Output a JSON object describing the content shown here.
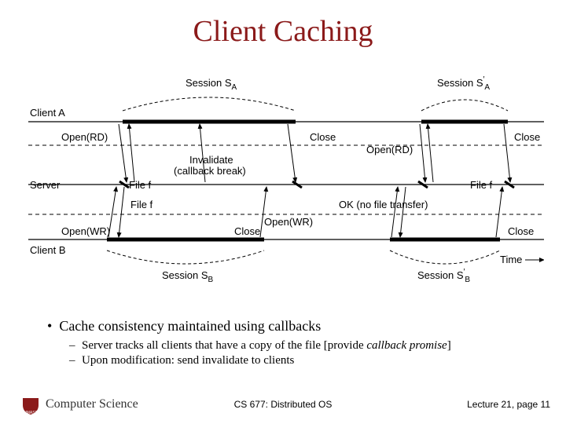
{
  "title": "Client Caching",
  "diagram": {
    "clientA": "Client A",
    "clientB": "Client B",
    "server": "Server",
    "openRD": "Open(RD)",
    "openWR": "Open(WR)",
    "close": "Close",
    "filef": "File f",
    "invalidate1": "Invalidate",
    "invalidate2": "(callback break)",
    "okNoTransfer": "OK (no file transfer)",
    "sessionSA": "Session S",
    "sessionSB": "Session S",
    "subA": "A",
    "subB": "B",
    "time": "Time"
  },
  "bullets": {
    "main": "Cache consistency maintained using callbacks",
    "sub1_a": "Server tracks all clients that have a copy of the file [provide ",
    "sub1_b": "callback promise",
    "sub1_c": "]",
    "sub2": "Upon modification: send invalidate to clients"
  },
  "footer": {
    "dept": "Computer Science",
    "course": "CS 677: Distributed OS",
    "page": "Lecture 21, page 11"
  }
}
